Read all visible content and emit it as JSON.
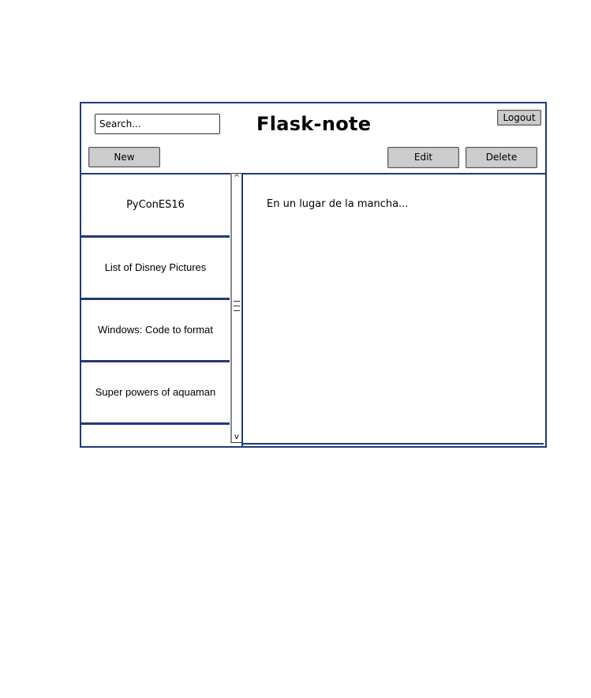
{
  "header": {
    "title": "Flask-note",
    "search": {
      "placeholder": "Search...",
      "value": ""
    },
    "logout_label": "Logout"
  },
  "toolbar": {
    "new_label": "New",
    "edit_label": "Edit",
    "delete_label": "Delete"
  },
  "notes_list": {
    "items": [
      {
        "label": "PyConES16"
      },
      {
        "label": "List of Disney Pictures"
      },
      {
        "label": "Windows: Code to format"
      },
      {
        "label": "Super powers of aquaman"
      },
      {
        "label": ""
      }
    ],
    "scrollbar": {
      "up_icon": "^",
      "down_icon": "v"
    }
  },
  "note_content": {
    "text": "En un lugar de la mancha..."
  },
  "colors": {
    "frame_border": "#1f3a7a",
    "button_bg": "#cccccc"
  }
}
